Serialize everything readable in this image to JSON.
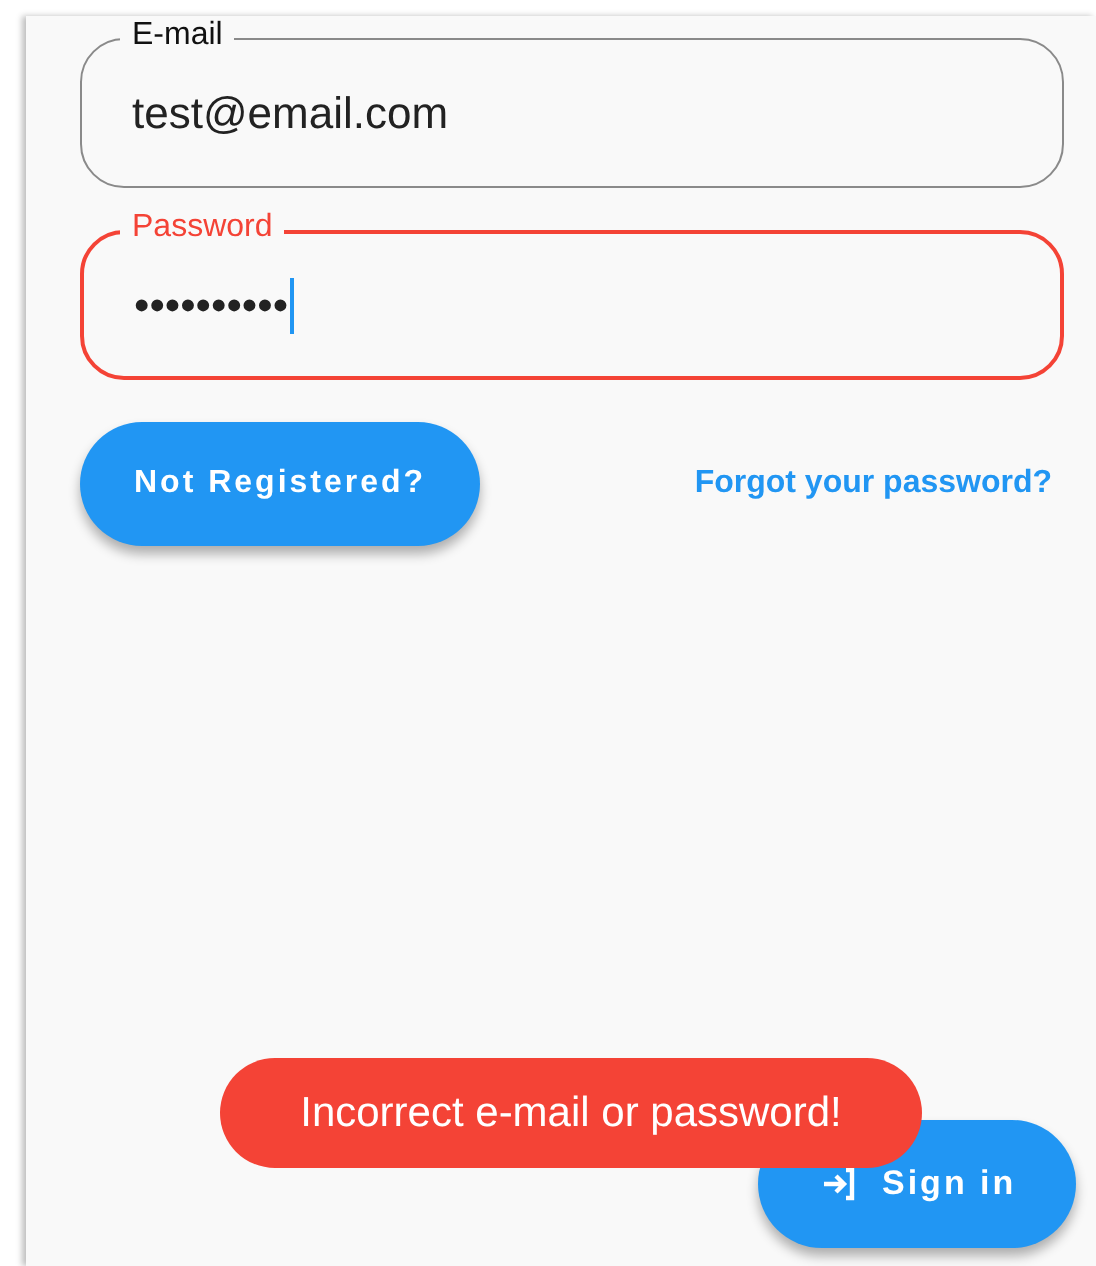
{
  "fields": [
    {
      "label": "E-mail",
      "value": "test@email.com",
      "error": false,
      "focused": false
    },
    {
      "label": "Password",
      "value": "••••••••••",
      "error": true,
      "focused": true
    }
  ],
  "register_button": "Not Registered?",
  "forgot_link": "Forgot your password?",
  "toast": "Incorrect e-mail or password!",
  "sign_in_button": "Sign in"
}
